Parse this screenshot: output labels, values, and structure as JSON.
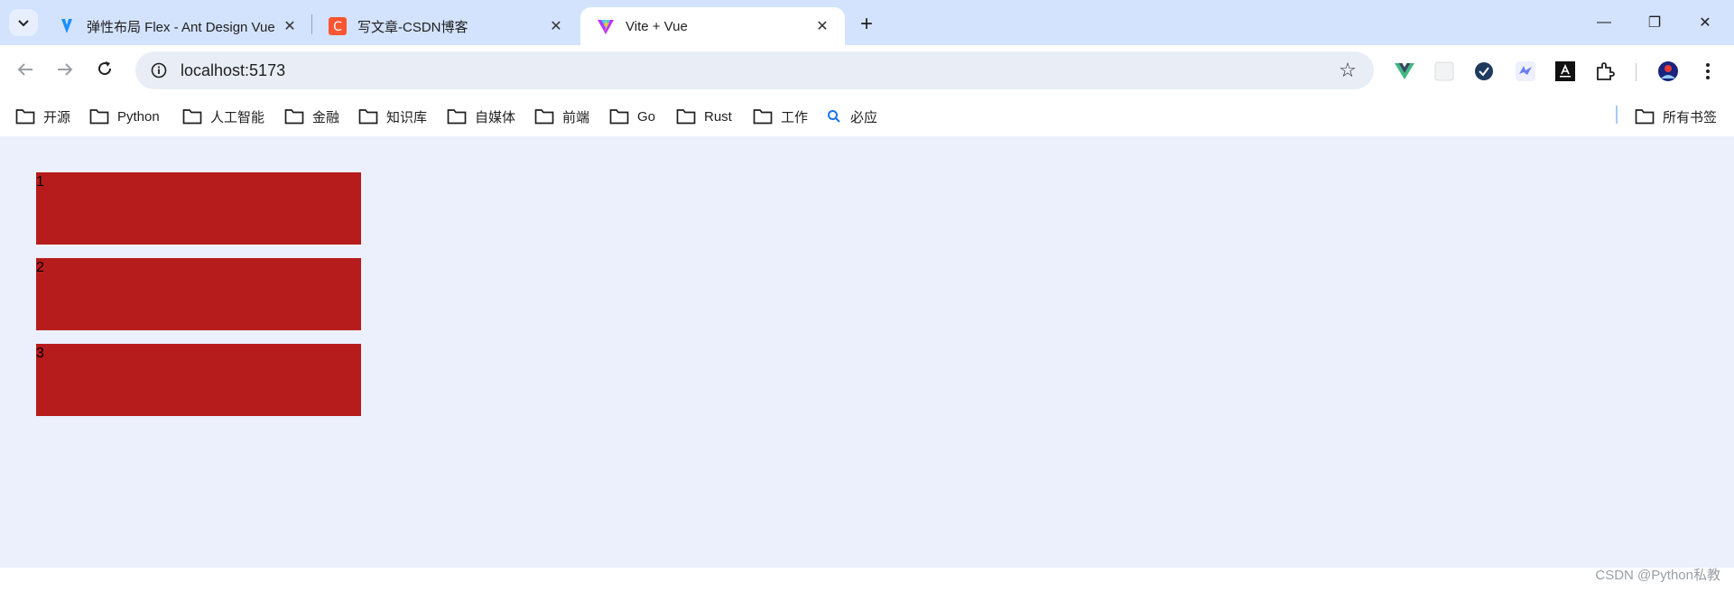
{
  "tabs": [
    {
      "title": "弹性布局 Flex - Ant Design Vue",
      "favicon": "ant-design-vue-icon"
    },
    {
      "title": "写文章-CSDN博客",
      "favicon": "csdn-icon"
    },
    {
      "title": "Vite + Vue",
      "favicon": "vite-icon",
      "active": true
    }
  ],
  "window_controls": {
    "minimize": "—",
    "restore": "❐",
    "close": "✕"
  },
  "address_bar": {
    "url": "localhost:5173"
  },
  "extensions": [
    "vue-devtools-icon",
    "blank-extension-icon",
    "check-extension-icon",
    "bird-extension-icon",
    "aitm-extension-icon",
    "puzzle-extensions-icon",
    "profile-avatar-icon",
    "menu-dots-icon"
  ],
  "bookmarks": [
    {
      "label": "开源",
      "type": "folder"
    },
    {
      "label": "Python",
      "type": "folder"
    },
    {
      "label": "人工智能",
      "type": "folder"
    },
    {
      "label": "金融",
      "type": "folder"
    },
    {
      "label": "知识库",
      "type": "folder"
    },
    {
      "label": "自媒体",
      "type": "folder"
    },
    {
      "label": "前端",
      "type": "folder"
    },
    {
      "label": "Go",
      "type": "folder"
    },
    {
      "label": "Rust",
      "type": "folder"
    },
    {
      "label": "工作",
      "type": "folder"
    },
    {
      "label": "必应",
      "type": "link"
    }
  ],
  "all_bookmarks": {
    "label": "所有书签"
  },
  "page": {
    "items": [
      {
        "label": "1"
      },
      {
        "label": "2"
      },
      {
        "label": "3"
      }
    ],
    "item_color": "#b71c1c",
    "background": "#ecf0fd"
  },
  "watermark": "CSDN @Python私教"
}
